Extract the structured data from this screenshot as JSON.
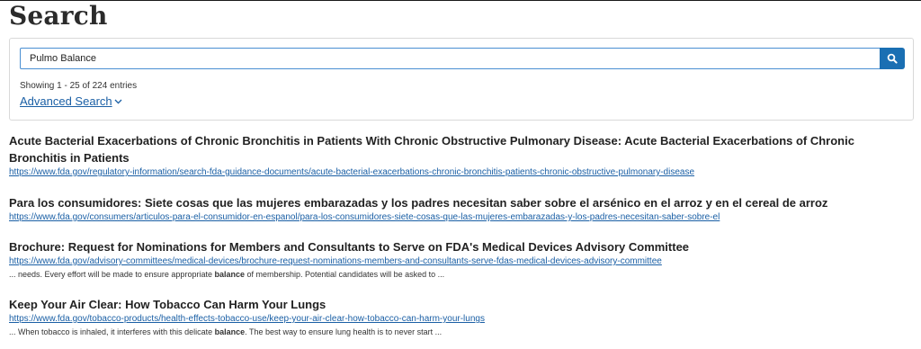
{
  "page": {
    "title": "Search"
  },
  "search": {
    "value": "Pulmo Balance",
    "entries_text": "Showing 1 - 25 of 224 entries",
    "advanced_label": "Advanced Search"
  },
  "icons": {
    "search_button": "search-icon",
    "advanced_toggle": "chevron-down-icon"
  },
  "colors": {
    "accent": "#1a6fb3",
    "link": "#1a5fa5",
    "input_border": "#4a8fd3"
  },
  "results": [
    {
      "title": "Acute Bacterial Exacerbations of Chronic Bronchitis in Patients With Chronic Obstructive Pulmonary Disease: Acute Bacterial Exacerbations of Chronic Bronchitis in Patients",
      "url": "https://www.fda.gov/regulatory-information/search-fda-guidance-documents/acute-bacterial-exacerbations-chronic-bronchitis-patients-chronic-obstructive-pulmonary-disease",
      "snippet_pre": "",
      "snippet_bold": "",
      "snippet_post": ""
    },
    {
      "title": "Para los consumidores: Siete cosas que las mujeres embarazadas y los padres necesitan saber sobre el arsénico en el arroz y en el cereal de arroz",
      "url": "https://www.fda.gov/consumers/articulos-para-el-consumidor-en-espanol/para-los-consumidores-siete-cosas-que-las-mujeres-embarazadas-y-los-padres-necesitan-saber-sobre-el",
      "snippet_pre": "",
      "snippet_bold": "",
      "snippet_post": ""
    },
    {
      "title": "Brochure: Request for Nominations for Members and Consultants to Serve on FDA's Medical Devices Advisory Committee",
      "url": "https://www.fda.gov/advisory-committees/medical-devices/brochure-request-nominations-members-and-consultants-serve-fdas-medical-devices-advisory-committee",
      "snippet_pre": "... needs. Every effort will be made to ensure appropriate ",
      "snippet_bold": "balance",
      "snippet_post": " of membership. Potential candidates will be asked to ..."
    },
    {
      "title": "Keep Your Air Clear: How Tobacco Can Harm Your Lungs",
      "url": "https://www.fda.gov/tobacco-products/health-effects-tobacco-use/keep-your-air-clear-how-tobacco-can-harm-your-lungs",
      "snippet_pre": "... When tobacco is inhaled, it interferes with this delicate ",
      "snippet_bold": "balance",
      "snippet_post": ". The best way to ensure lung health is to never start ..."
    }
  ]
}
